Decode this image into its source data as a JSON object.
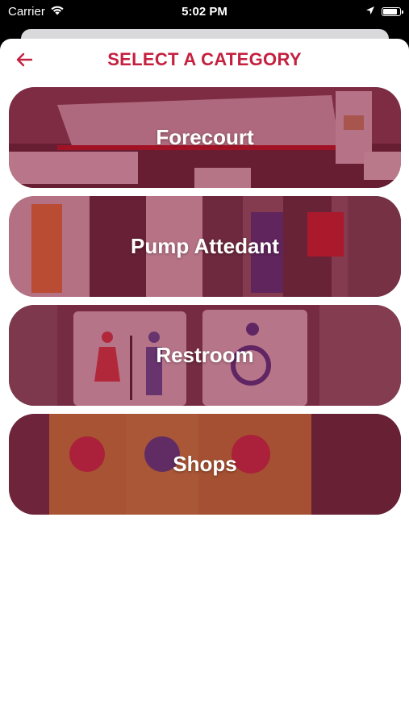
{
  "status_bar": {
    "carrier": "Carrier",
    "time": "5:02 PM"
  },
  "header": {
    "title": "SELECT A CATEGORY",
    "back_icon": "arrow-left-icon"
  },
  "colors": {
    "accent": "#c4203f",
    "overlay": "#8c1437"
  },
  "categories": [
    {
      "label": "Forecourt"
    },
    {
      "label": "Pump Attedant"
    },
    {
      "label": "Restroom"
    },
    {
      "label": "Shops"
    }
  ]
}
